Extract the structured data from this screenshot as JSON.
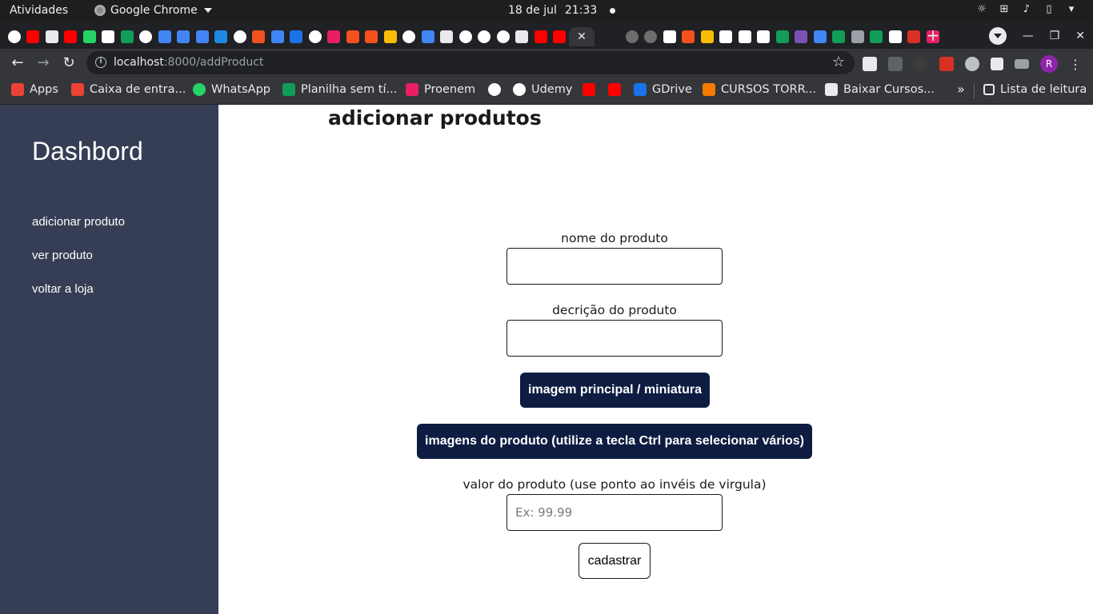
{
  "system_bar": {
    "activities": "Atividades",
    "app_name": "Google Chrome",
    "date": "18 de jul",
    "time": "21:33"
  },
  "browser": {
    "tab_icons": [
      "udemy-icon",
      "youtube-icon",
      "mail-icon",
      "youtube-icon",
      "whatsapp-icon",
      "notion-icon",
      "sheets-icon",
      "globe-icon",
      "feather-icon",
      "feather-icon",
      "feather-icon",
      "edge-icon",
      "google-icon",
      "laravel-icon",
      "translate-icon",
      "photo-icon",
      "globe-icon",
      "proenem-icon",
      "laravel-icon",
      "laravel-icon",
      "chart-icon",
      "globe-icon",
      "feather-icon",
      "speaker-icon",
      "globe-icon",
      "globe-icon",
      "globe-icon",
      "mail-icon",
      "youtube-icon",
      "youtube-icon"
    ],
    "tab_icons_right": [
      "github-icon",
      "github-icon",
      "codepen-icon",
      "laravel-icon",
      "chart-icon",
      "codepen-icon",
      "google-icon",
      "codepen-icon",
      "w-icon",
      "bootstrap-icon",
      "feather-icon",
      "sheets-icon",
      "download-icon",
      "sheets-icon",
      "ut-icon",
      "qa-icon",
      "proenem-icon"
    ],
    "url_host": "localhost",
    "url_rest": ":8000/addProduct",
    "profile_initial": "R",
    "bookmarks": [
      {
        "label": "Apps",
        "icon": "apps-grid-icon"
      },
      {
        "label": "Caixa de entra...",
        "icon": "gmail-icon"
      },
      {
        "label": "WhatsApp",
        "icon": "whatsapp-icon"
      },
      {
        "label": "Planilha sem tí...",
        "icon": "sheets-icon"
      },
      {
        "label": "Proenem",
        "icon": "proenem-icon"
      },
      {
        "label": "",
        "icon": "globe-icon"
      },
      {
        "label": "Udemy",
        "icon": "udemy-icon"
      },
      {
        "label": "",
        "icon": "youtube-icon"
      },
      {
        "label": "",
        "icon": "youtube-icon"
      },
      {
        "label": "GDrive",
        "icon": "gdrive-icon"
      },
      {
        "label": "CURSOS TORR...",
        "icon": "blogger-icon"
      },
      {
        "label": "Baixar Cursos...",
        "icon": "drive-icon"
      }
    ],
    "reading_list": "Lista de leitura"
  },
  "sidebar": {
    "brand": "Dashbord",
    "items": [
      {
        "label": "adicionar produto"
      },
      {
        "label": "ver produto"
      },
      {
        "label": "voltar a loja"
      }
    ]
  },
  "main": {
    "title": "adicionar produtos",
    "form": {
      "name_label": "nome do produto",
      "name_value": "",
      "description_label": "decrição do produto",
      "description_value": "",
      "main_image_button": "imagem principal / miniatura",
      "images_button": "imagens do produto (utilize a tecla Ctrl para selecionar vários)",
      "price_label": "valor do produto (use ponto ao invéis de virgula)",
      "price_placeholder": "Ex: 99.99",
      "submit_label": "cadastrar"
    }
  },
  "colors": {
    "sidebar_bg": "#363e55",
    "button_bg": "#0d1c40",
    "chrome_frame": "#202124",
    "chrome_toolbar": "#35363a"
  }
}
